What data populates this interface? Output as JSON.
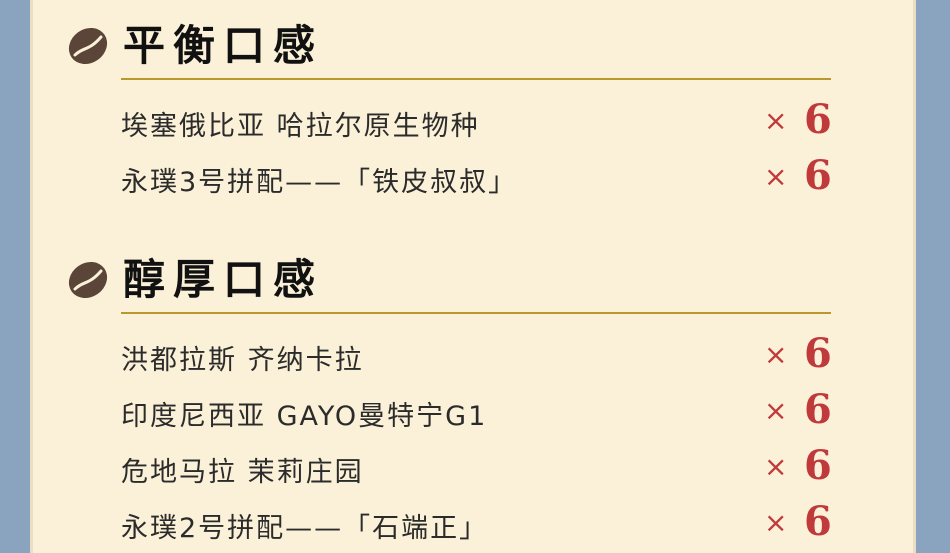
{
  "sections": [
    {
      "title": "平衡口感",
      "items": [
        {
          "name": "埃塞俄比亚 哈拉尔原生物种",
          "times": "×",
          "qty": "6"
        },
        {
          "name": "永璞3号拼配——「铁皮叔叔」",
          "times": "×",
          "qty": "6"
        }
      ]
    },
    {
      "title": "醇厚口感",
      "items": [
        {
          "name": "洪都拉斯 齐纳卡拉",
          "times": "×",
          "qty": "6"
        },
        {
          "name": "印度尼西亚 GAYO曼特宁G1",
          "times": "×",
          "qty": "6"
        },
        {
          "name": "危地马拉 茉莉庄园",
          "times": "×",
          "qty": "6"
        },
        {
          "name": "永璞2号拼配——「石端正」",
          "times": "×",
          "qty": "6"
        }
      ]
    }
  ],
  "colors": {
    "background": "#8aa3bf",
    "card": "#fbf1d8",
    "rule": "#b89a2c",
    "accent": "#c0393b",
    "bean": "#5a4538"
  },
  "icons": [
    "coffee-bean-icon"
  ]
}
